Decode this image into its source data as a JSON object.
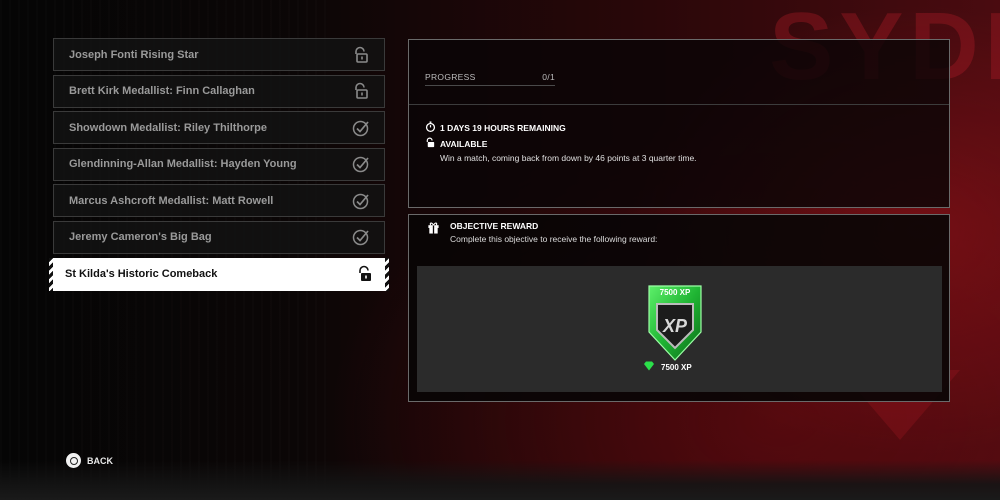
{
  "background": {
    "team_word": "SYDN",
    "accent": "#a01a22"
  },
  "objectives": [
    {
      "label": "Joseph Fonti Rising Star",
      "status": "unlocked",
      "icon": "unlock-icon"
    },
    {
      "label": "Brett Kirk Medallist: Finn Callaghan",
      "status": "unlocked",
      "icon": "unlock-icon"
    },
    {
      "label": "Showdown Medallist: Riley Thilthorpe",
      "status": "completed",
      "icon": "check-circle-icon"
    },
    {
      "label": "Glendinning-Allan Medallist: Hayden Young",
      "status": "completed",
      "icon": "check-circle-icon"
    },
    {
      "label": "Marcus Ashcroft Medallist: Matt Rowell",
      "status": "completed",
      "icon": "check-circle-icon"
    },
    {
      "label": "Jeremy Cameron's Big Bag",
      "status": "completed",
      "icon": "check-circle-icon"
    },
    {
      "label": "St Kilda's Historic Comeback",
      "status": "selected",
      "icon": "unlock-icon"
    }
  ],
  "detail": {
    "progress_label": "PROGRESS",
    "progress_value": "0/1",
    "time_remaining": "1 DAYS 19 HOURS REMAINING",
    "availability": "AVAILABLE",
    "description": "Win a match, coming back from down by 46 points at 3 quarter time."
  },
  "reward": {
    "title": "OBJECTIVE REWARD",
    "subtitle": "Complete this objective to receive the following reward:",
    "badge_caption": "7500 XP",
    "badge_logo": "XP",
    "amount": "7500 XP",
    "badge_color": "#23c43a"
  },
  "footer": {
    "back_label": "BACK"
  }
}
